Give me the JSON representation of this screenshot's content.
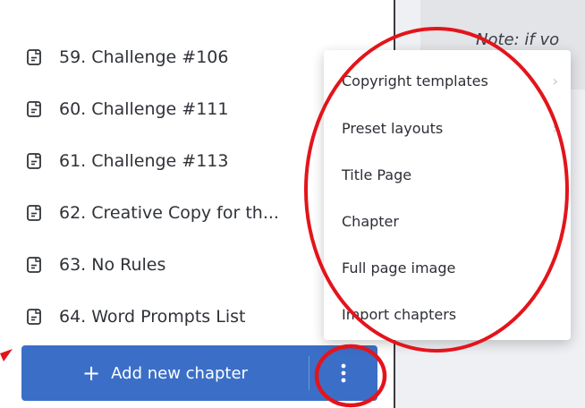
{
  "chapters": [
    {
      "label": "59. Challenge #106"
    },
    {
      "label": "60. Challenge #111"
    },
    {
      "label": "61. Challenge #113"
    },
    {
      "label": "62. Creative Copy for th..."
    },
    {
      "label": "63. No Rules"
    },
    {
      "label": "64. Word Prompts List"
    }
  ],
  "add_button_label": "Add new chapter",
  "note_text": "Note: if vo",
  "menu": {
    "items": [
      {
        "label": "Copyright templates",
        "has_submenu": true
      },
      {
        "label": "Preset layouts",
        "has_submenu": true
      },
      {
        "label": "Title Page",
        "has_submenu": false
      },
      {
        "label": "Chapter",
        "has_submenu": false
      },
      {
        "label": "Full page image",
        "has_submenu": false
      },
      {
        "label": "Import chapters",
        "has_submenu": false
      }
    ]
  },
  "colors": {
    "accent_blue": "#3b6fc7",
    "annotation_red": "#e3141b"
  },
  "icons": {
    "chapter": "document-icon",
    "add": "plus-icon",
    "more": "kebab-vertical-icon",
    "submenu": "chevron-right-icon"
  }
}
